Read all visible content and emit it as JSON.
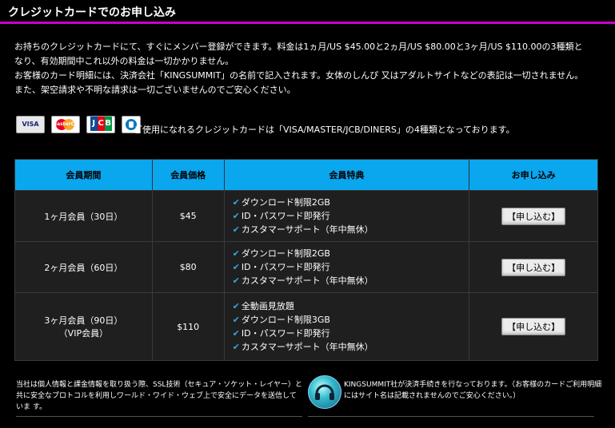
{
  "header": {
    "title": "クレジットカードでのお申し込み"
  },
  "intro": {
    "lines": [
      "お持ちのクレジットカードにて、すぐにメンバー登録ができます。料金は1ヵ月/US $45.00と2ヵ月/US $80.00と3ヶ月/US $110.00の3種類と",
      "なり、有効期間中これ以外の料金は一切かかりません。",
      "お客様のカード明細には、決済会社「KINGSUMMIT」の名前で記入されます。女体のしんぴ 又はアダルトサイトなどの表記は一切されません。",
      "また、架空請求や不明な請求は一切ございませんのでご安心ください。"
    ]
  },
  "cards": {
    "labels": {
      "visa": "VISA",
      "master": "MasterCard",
      "jcb": [
        "J",
        "C",
        "B"
      ]
    },
    "text": "ご使用になれるクレジットカードは「VISA/MASTER/JCB/DINERS」の4種類となっております。"
  },
  "table": {
    "headers": [
      "会員期間",
      "会員価格",
      "会員特典",
      "お申し込み"
    ],
    "rows": [
      {
        "period": [
          "1ヶ月会員（30日）"
        ],
        "price": "$45",
        "benefits": [
          "ダウンロード制限2GB",
          "ID・パスワード即発行",
          "カスタマーサポート（年中無休）"
        ],
        "button": "【申し込む】"
      },
      {
        "period": [
          "2ヶ月会員（60日）"
        ],
        "price": "$80",
        "benefits": [
          "ダウンロード制限2GB",
          "ID・パスワード即発行",
          "カスタマーサポート（年中無休）"
        ],
        "button": "【申し込む】"
      },
      {
        "period": [
          "3ヶ月会員（90日）",
          "（VIP会員）"
        ],
        "price": "$110",
        "benefits": [
          "全動画見放題",
          "ダウンロード制限3GB",
          "ID・パスワード即発行",
          "カスタマーサポート（年中無休）"
        ],
        "button": "【申し込む】"
      }
    ]
  },
  "footer": {
    "left": "当社は個人情報と課金情報を取り扱う際、SSL技術（セキュア・ソケット・レイヤー）と共に安全なプロトコルを利用しワールド・ワイド・ウェブ上で安全にデータを送信していま す。",
    "right": "KINGSUMMIT社が決済手続きを行なっております。（お客様のカードご利用明細にはサイト名は記載されませんのでご安心ください。）"
  },
  "colors": {
    "accent": "#cc00cc",
    "table_header": "#0aa6ee",
    "check": "#39a3e0"
  }
}
